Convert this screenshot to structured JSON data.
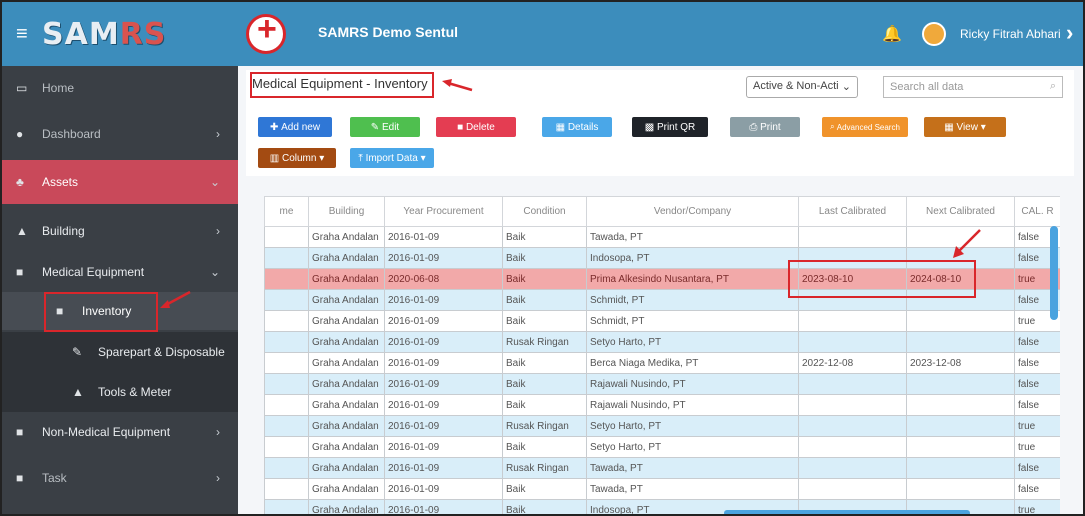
{
  "header": {
    "brand": "SAMRS",
    "app_title": "SAMRS Demo Sentul",
    "user_name": "Ricky Fitrah Abhari"
  },
  "sidebar": {
    "items": [
      {
        "label": "Home",
        "icon": "laptop-icon"
      },
      {
        "label": "Dashboard",
        "icon": "palette-icon"
      },
      {
        "label": "Assets",
        "icon": "cubes-icon"
      },
      {
        "label": "Building",
        "icon": "building-icon"
      },
      {
        "label": "Medical Equipment",
        "icon": "clipboard-icon"
      },
      {
        "label": "Inventory",
        "icon": "box-icon"
      },
      {
        "label": "Sparepart & Disposable",
        "icon": "wrench-icon"
      },
      {
        "label": "Tools & Meter",
        "icon": "tools-icon"
      },
      {
        "label": "Non-Medical Equipment",
        "icon": "clipboard-icon"
      },
      {
        "label": "Task",
        "icon": "clipboard-icon"
      }
    ]
  },
  "page": {
    "title": "Medical Equipment - Inventory",
    "status_filter": "Active & Non-Acti",
    "search_placeholder": "Search all data"
  },
  "toolbar": {
    "add": "Add new",
    "edit": "Edit",
    "delete": "Delete",
    "details": "Details",
    "print_qr": "Print QR",
    "print": "Print",
    "advanced_search": "Advanced Search",
    "view": "View",
    "column": "Column",
    "import": "Import Data"
  },
  "colors": {
    "accent": "#3c8dbc",
    "sidebar": "#3a3f45",
    "assets_active": "#c9495a",
    "highlight_row": "#f2a9a9"
  },
  "table": {
    "columns": [
      "me",
      "Building",
      "Year Procurement",
      "Condition",
      "Vendor/Company",
      "Last Calibrated",
      "Next Calibrated",
      "CAL. R"
    ],
    "rows": [
      [
        "",
        "Graha Andalan",
        "2016-01-09",
        "Baik",
        "Tawada, PT",
        "",
        "",
        "false"
      ],
      [
        "",
        "Graha Andalan",
        "2016-01-09",
        "Baik",
        "Indosopa, PT",
        "",
        "",
        "false"
      ],
      [
        "",
        "Graha Andalan",
        "2020-06-08",
        "Baik",
        "Prima Alkesindo Nusantara, PT",
        "2023-08-10",
        "2024-08-10",
        "true"
      ],
      [
        "",
        "Graha Andalan",
        "2016-01-09",
        "Baik",
        "Schmidt, PT",
        "",
        "",
        "false"
      ],
      [
        "",
        "Graha Andalan",
        "2016-01-09",
        "Baik",
        "Schmidt, PT",
        "",
        "",
        "true"
      ],
      [
        "",
        "Graha Andalan",
        "2016-01-09",
        "Rusak Ringan",
        "Setyo Harto, PT",
        "",
        "",
        "false"
      ],
      [
        "",
        "Graha Andalan",
        "2016-01-09",
        "Baik",
        "Berca Niaga Medika, PT",
        "2022-12-08",
        "2023-12-08",
        "false"
      ],
      [
        "",
        "Graha Andalan",
        "2016-01-09",
        "Baik",
        "Rajawali Nusindo, PT",
        "",
        "",
        "false"
      ],
      [
        "",
        "Graha Andalan",
        "2016-01-09",
        "Baik",
        "Rajawali Nusindo, PT",
        "",
        "",
        "false"
      ],
      [
        "",
        "Graha Andalan",
        "2016-01-09",
        "Rusak Ringan",
        "Setyo Harto, PT",
        "",
        "",
        "true"
      ],
      [
        "",
        "Graha Andalan",
        "2016-01-09",
        "Baik",
        "Setyo Harto, PT",
        "",
        "",
        "true"
      ],
      [
        "",
        "Graha Andalan",
        "2016-01-09",
        "Rusak Ringan",
        "Tawada, PT",
        "",
        "",
        "false"
      ],
      [
        "",
        "Graha Andalan",
        "2016-01-09",
        "Baik",
        "Tawada, PT",
        "",
        "",
        "false"
      ],
      [
        "",
        "Graha Andalan",
        "2016-01-09",
        "Baik",
        "Indosopa, PT",
        "",
        "",
        "true"
      ]
    ]
  }
}
